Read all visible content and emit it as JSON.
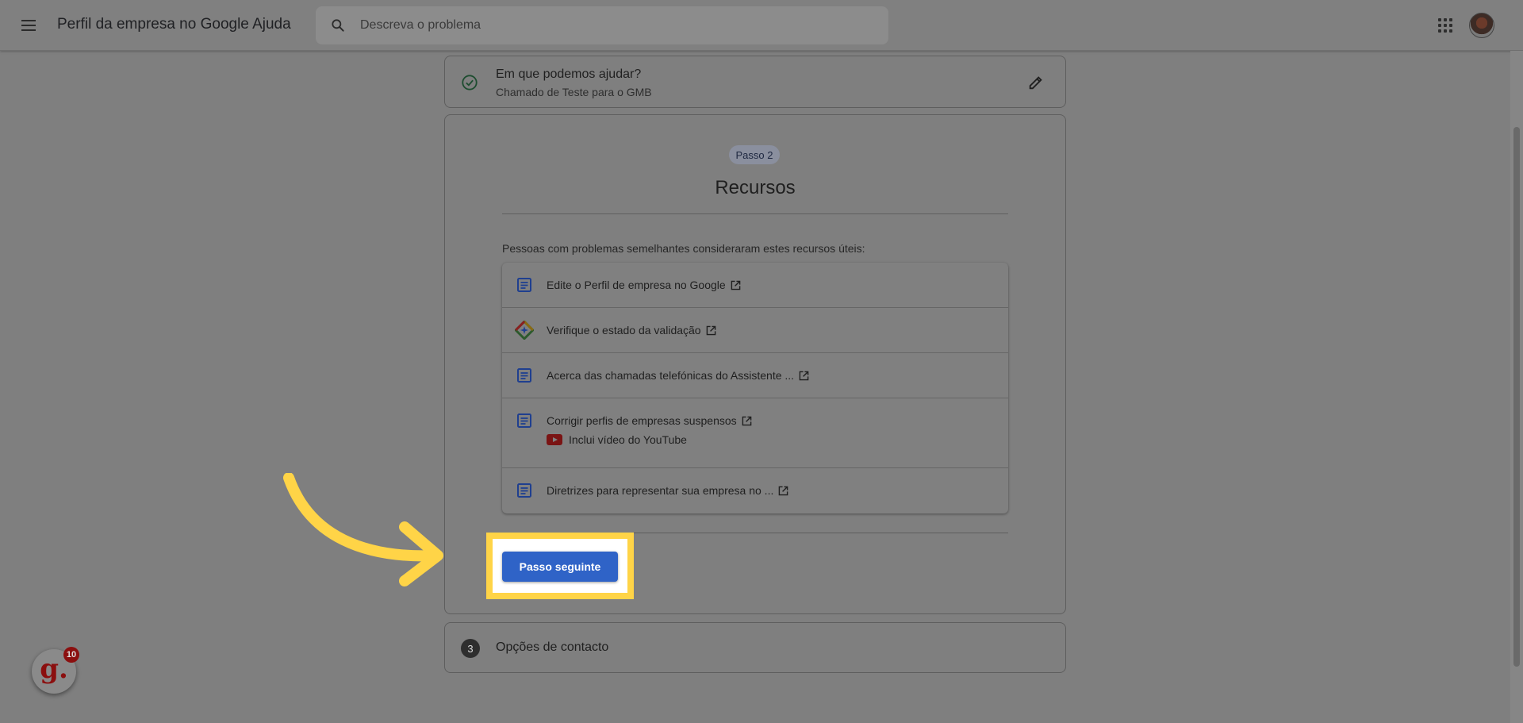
{
  "header": {
    "app_title": "Perfil da empresa no Google Ajuda",
    "search_placeholder": "Descreva o problema"
  },
  "help_card": {
    "title": "Em que podemos ajudar?",
    "subtitle": "Chamado de Teste para o GMB"
  },
  "resources_card": {
    "step_badge": "Passo 2",
    "title": "Recursos",
    "intro": "Pessoas com problemas semelhantes consideraram estes recursos úteis:",
    "items": [
      {
        "label": "Edite o Perfil de empresa no Google",
        "icon": "document-icon"
      },
      {
        "label": "Verifique o estado da validação",
        "icon": "diamond-logo-icon"
      },
      {
        "label": "Acerca das chamadas telefónicas do Assistente ...",
        "icon": "document-icon"
      },
      {
        "label": "Corrigir perfis de empresas suspensos",
        "icon": "document-icon",
        "extra": "Inclui vídeo do YouTube"
      },
      {
        "label": "Diretrizes para representar sua empresa no ...",
        "icon": "document-icon"
      }
    ],
    "next_button": "Passo seguinte"
  },
  "contact_card": {
    "step_number": "3",
    "label": "Opções de contacto"
  },
  "badge": {
    "letter": "g.",
    "count": "10"
  },
  "colors": {
    "highlight": "#ffd447",
    "button": "#2f63c7",
    "doc_icon": "#1f3f8f"
  }
}
